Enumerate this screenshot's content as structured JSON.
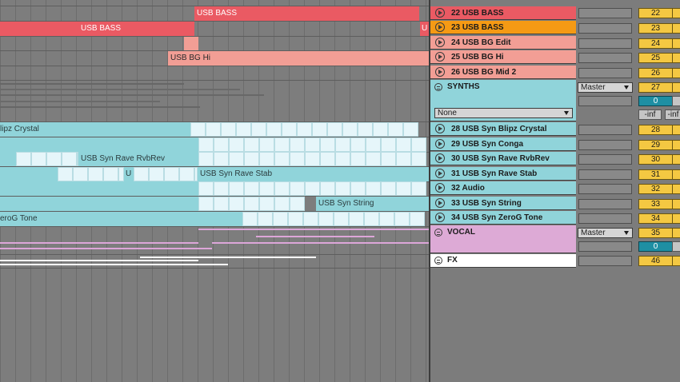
{
  "colors": {
    "bass": "#ea5a63",
    "bass_selected": "#f59a14",
    "bass_light": "#f29e95",
    "synths": "#90d4da",
    "synths_light": "#e6f6fa",
    "vocal": "#ddaad6",
    "fx": "#ffffff",
    "number": "#f4c842"
  },
  "clips": {
    "bass1": "USB BASS",
    "bass2": "USB BASS",
    "bass2_end": "U",
    "bg_hi": "USB BG Hi",
    "crystal": "lipz Crystal",
    "rvb": "USB Syn Rave RvbRev",
    "stab_short": "U",
    "stab": "USB Syn Rave Stab",
    "string": "USB Syn String",
    "zerog": "eroG Tone"
  },
  "tracks": [
    {
      "name": "22 USB BASS",
      "number": "22"
    },
    {
      "name": "23 USB BASS",
      "number": "23"
    },
    {
      "name": "24 USB BG Edit",
      "number": "24"
    },
    {
      "name": "25 USB BG Hi",
      "number": "25"
    },
    {
      "name": "26 USB BG Mid 2",
      "number": "26"
    },
    {
      "name": "28 USB Syn Blipz Crystal",
      "number": "28"
    },
    {
      "name": "29 USB Syn Conga",
      "number": "29"
    },
    {
      "name": "30 USB Syn Rave RvbRev",
      "number": "30"
    },
    {
      "name": "31 USB Syn Rave Stab",
      "number": "31"
    },
    {
      "name": "32 Audio",
      "number": "32"
    },
    {
      "name": "33 USB Syn String",
      "number": "33"
    },
    {
      "name": "34 USB Syn ZeroG Tone",
      "number": "34"
    }
  ],
  "groups": {
    "synths": {
      "name": "SYNTHS",
      "number": "27",
      "routing": "Master",
      "volume": "0",
      "input": "None",
      "inf_left": "-inf",
      "inf_right": "-inf"
    },
    "vocal": {
      "name": "VOCAL",
      "number": "35",
      "routing": "Master",
      "volume": "0"
    },
    "fx": {
      "name": "FX",
      "number": "46"
    }
  }
}
